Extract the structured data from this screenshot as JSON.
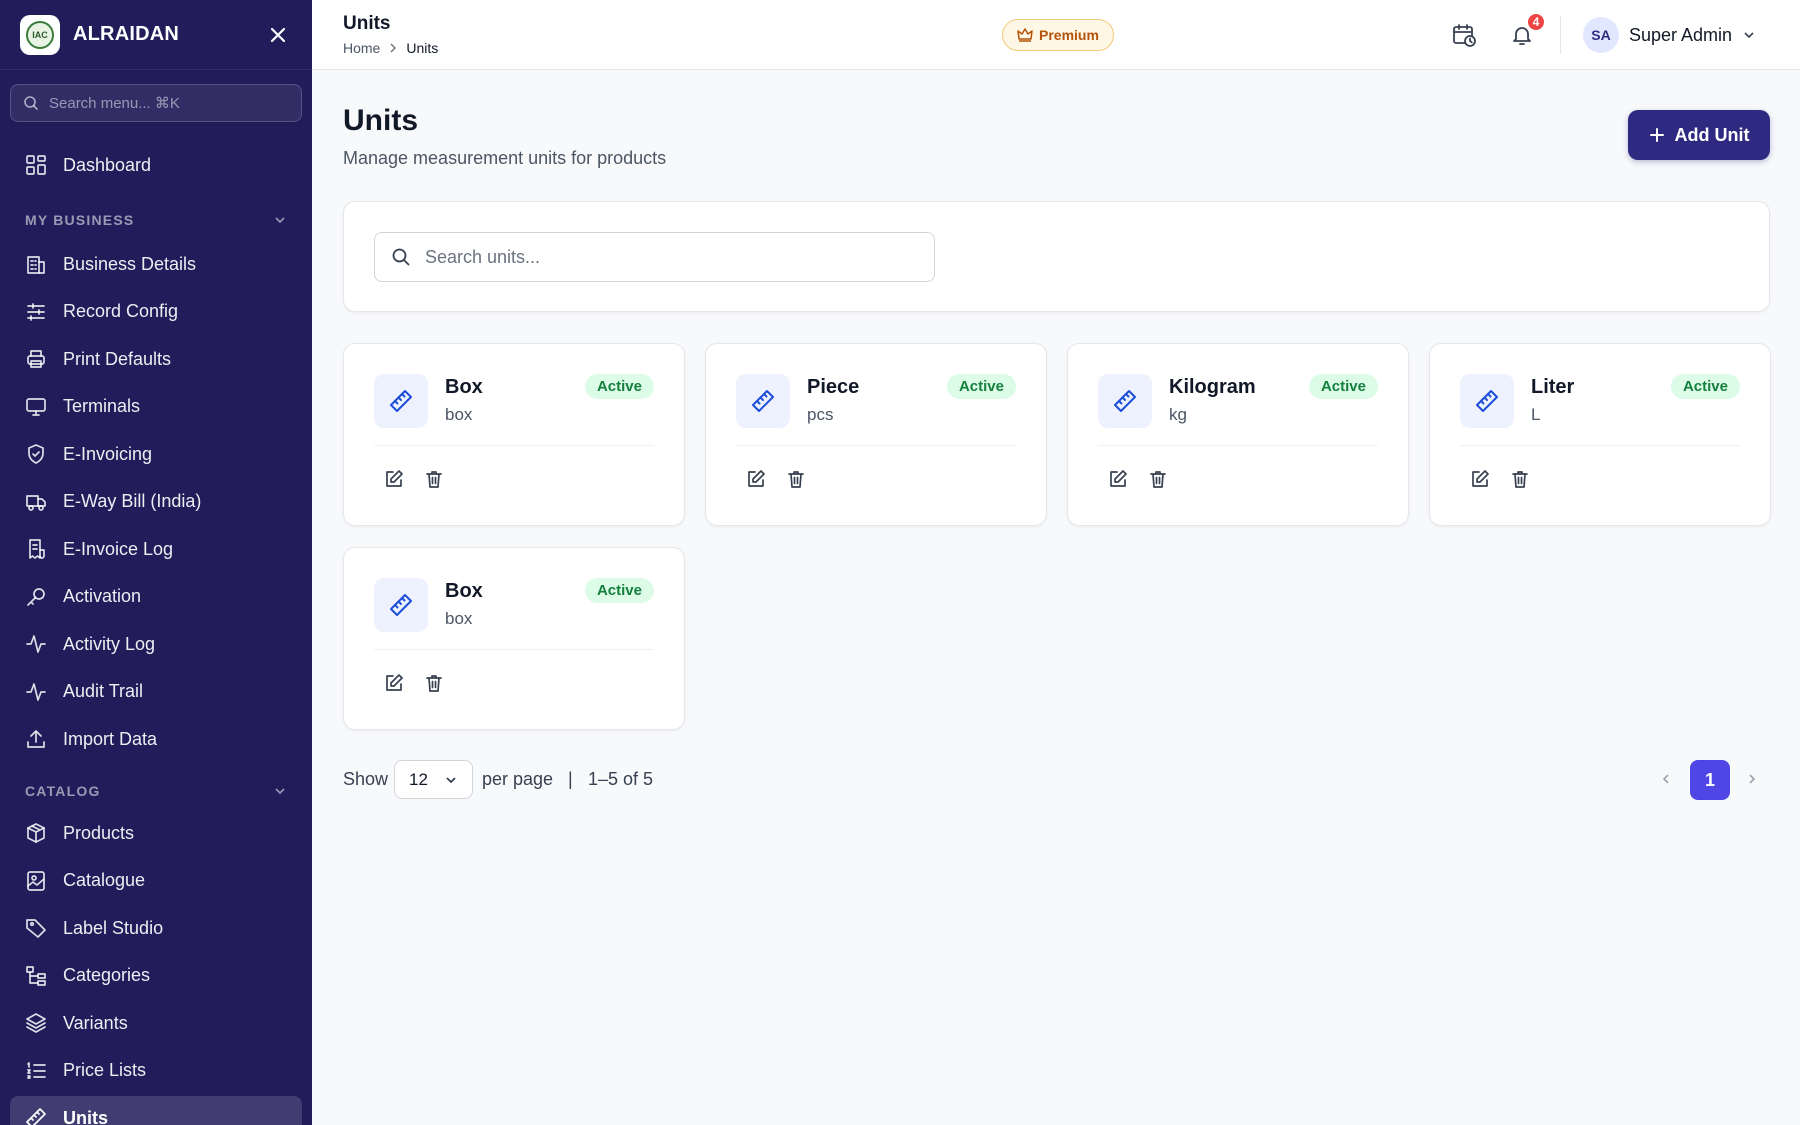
{
  "sidebar": {
    "brand": "ALRAIDAN",
    "logo_text": "IAC",
    "search_placeholder": "Search menu... ⌘K",
    "dashboard": "Dashboard",
    "section_business": "MY BUSINESS",
    "business_items": [
      {
        "label": "Business Details",
        "icon": "building-icon"
      },
      {
        "label": "Record Config",
        "icon": "sliders-icon"
      },
      {
        "label": "Print Defaults",
        "icon": "printer-icon"
      },
      {
        "label": "Terminals",
        "icon": "monitor-icon"
      },
      {
        "label": "E-Invoicing",
        "icon": "shield-check-icon"
      },
      {
        "label": "E-Way Bill (India)",
        "icon": "truck-icon"
      },
      {
        "label": "E-Invoice Log",
        "icon": "receipt-icon"
      },
      {
        "label": "Activation",
        "icon": "key-icon"
      },
      {
        "label": "Activity Log",
        "icon": "activity-icon"
      },
      {
        "label": "Audit Trail",
        "icon": "activity-icon"
      },
      {
        "label": "Import Data",
        "icon": "upload-icon"
      }
    ],
    "section_catalog": "CATALOG",
    "catalog_items": [
      {
        "label": "Products",
        "icon": "box-icon"
      },
      {
        "label": "Catalogue",
        "icon": "image-book-icon"
      },
      {
        "label": "Label Studio",
        "icon": "tag-icon"
      },
      {
        "label": "Categories",
        "icon": "tree-icon"
      },
      {
        "label": "Variants",
        "icon": "layers-icon"
      },
      {
        "label": "Price Lists",
        "icon": "list-ordered-icon"
      },
      {
        "label": "Units",
        "icon": "ruler-icon"
      }
    ]
  },
  "topbar": {
    "title": "Units",
    "breadcrumb_home": "Home",
    "breadcrumb_current": "Units",
    "premium_label": "Premium",
    "notification_count": "4",
    "user_initials": "SA",
    "user_name": "Super Admin"
  },
  "main": {
    "heading": "Units",
    "subtitle": "Manage measurement units for products",
    "add_button": "Add Unit",
    "search_placeholder": "Search units...",
    "units": [
      {
        "name": "Box",
        "abbr": "box",
        "status": "Active"
      },
      {
        "name": "Piece",
        "abbr": "pcs",
        "status": "Active"
      },
      {
        "name": "Kilogram",
        "abbr": "kg",
        "status": "Active"
      },
      {
        "name": "Liter",
        "abbr": "L",
        "status": "Active"
      },
      {
        "name": "Box",
        "abbr": "box",
        "status": "Active"
      }
    ]
  },
  "pagination": {
    "show_label": "Show",
    "per_page_value": "12",
    "per_page_label": "per page",
    "separator": "|",
    "range_text": "1–5 of 5",
    "current_page": "1"
  },
  "colors": {
    "sidebar_bg": "#221c5a",
    "primary": "#2e2a82",
    "page_active": "#4f46e5",
    "status_green": "#15803d",
    "badge_red": "#ef4444"
  }
}
